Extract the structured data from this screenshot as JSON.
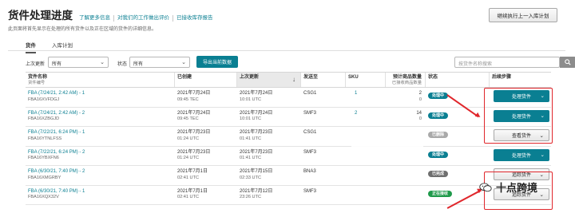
{
  "header": {
    "title": "货件处理进度",
    "links": [
      "了解更多信息",
      "对我们的工作做出评价",
      "已接收库存报告"
    ],
    "top_button": "继续执行上一入库计划",
    "description": "此页面将首先显示在处理的所有货件以及正在区域的货件的详细信息。"
  },
  "tabs": [
    {
      "label": "货件",
      "active": true
    },
    {
      "label": "入库计划",
      "active": false
    }
  ],
  "filters": {
    "last_updated_label": "上次更新",
    "last_updated_value": "所有",
    "status_label": "状态",
    "status_value": "所有",
    "export_button": "导出当前数据",
    "search_placeholder": "按货件名称搜索"
  },
  "table": {
    "columns": [
      {
        "label": "货件名称",
        "sub": "货件编号"
      },
      {
        "label": "已创建",
        "sub": ""
      },
      {
        "label": "上次更新",
        "sub": ""
      },
      {
        "label": "发送至",
        "sub": ""
      },
      {
        "label": "SKU",
        "sub": ""
      },
      {
        "label": "预计商品数量",
        "sub": "已接收商品数量"
      },
      {
        "label": "状态",
        "sub": ""
      },
      {
        "label": "后续步骤",
        "sub": ""
      }
    ],
    "rows": [
      {
        "name": "FBA (7/24/21, 2:42 AM) - 1",
        "id": "FBA16XVFDGJ",
        "created_date": "2021年7月24日",
        "created_time": "09:45 TEC",
        "updated_date": "2021年7月24日",
        "updated_time": "10:01 UTC",
        "ship_to": "CSG1",
        "sku": "1",
        "expected": "2",
        "received": "0",
        "status": "处理中",
        "status_color": "#0a7f92",
        "action": "处理货件",
        "action_style": "primary"
      },
      {
        "name": "FBA (7/24/21, 2:42 AM) - 2",
        "id": "FBA16XZBGJD",
        "created_date": "2021年7月24日",
        "created_time": "09:45 TEC",
        "updated_date": "2021年7月24日",
        "updated_time": "10:01 UTC",
        "ship_to": "SMF3",
        "sku": "2",
        "expected": "14",
        "received": "0",
        "status": "处理中",
        "status_color": "#0a7f92",
        "action": "处理货件",
        "action_style": "primary"
      },
      {
        "name": "FBA (7/22/21, 6:24 PM) - 1",
        "id": "FBA16YTNLFSS",
        "created_date": "2021年7月23日",
        "created_time": "01:24 UTC",
        "updated_date": "2021年7月23日",
        "updated_time": "01:41 UTC",
        "ship_to": "CSG1",
        "sku": "",
        "expected": "",
        "received": "",
        "status": "已删除",
        "status_color": "#a9a9a9",
        "action": "查看货件",
        "action_style": "secondary"
      },
      {
        "name": "FBA (7/22/21, 6:24 PM) - 2",
        "id": "FBA16YBXFN6",
        "created_date": "2021年7月23日",
        "created_time": "01:24 UTC",
        "updated_date": "2021年7月23日",
        "updated_time": "01:41 UTC",
        "ship_to": "SMF3",
        "sku": "",
        "expected": "",
        "received": "",
        "status": "处理中",
        "status_color": "#0a7f92",
        "action": "处理货件",
        "action_style": "primary"
      },
      {
        "name": "FBA (6/30/21, 7:40 PM) - 2",
        "id": "FBA16XMGRBY",
        "created_date": "2021年7月1日",
        "created_time": "02:41 UTC",
        "updated_date": "2021年7月15日",
        "updated_time": "02:33 UTC",
        "ship_to": "BNA3",
        "sku": "",
        "expected": "",
        "received": "",
        "status": "已完成",
        "status_color": "#6f6f6f",
        "action": "追踪货件",
        "action_style": "secondary"
      },
      {
        "name": "FBA (6/30/21, 7:40 PM) - 1",
        "id": "FBA16XQX32V",
        "created_date": "2021年7月1日",
        "created_time": "02:41 UTC",
        "updated_date": "2021年7月12日",
        "updated_time": "23:26 UTC",
        "ship_to": "SMF3",
        "sku": "",
        "expected": "",
        "received": "",
        "status": "正在接收",
        "status_color": "#1f9a4b",
        "action": "追踪货件",
        "action_style": "secondary"
      }
    ]
  },
  "watermark": {
    "text": "十点跨境"
  },
  "colors": {
    "brand": "#0a7f92",
    "annotation_red": "#e0262b"
  }
}
